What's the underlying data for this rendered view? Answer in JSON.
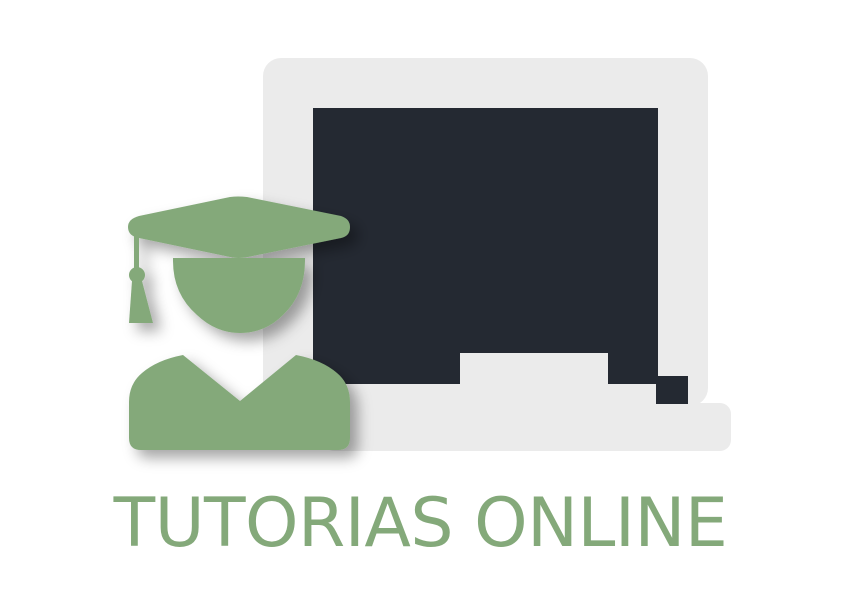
{
  "logo": {
    "text": "TUTORIAS ONLINE",
    "icons": {
      "laptop": "laptop-icon",
      "student": "graduate-student-icon"
    }
  },
  "colors": {
    "background": "#ffffff",
    "brand_green": "#84a97a",
    "laptop_frame": "#ebebeb",
    "laptop_screen": "#242932"
  }
}
